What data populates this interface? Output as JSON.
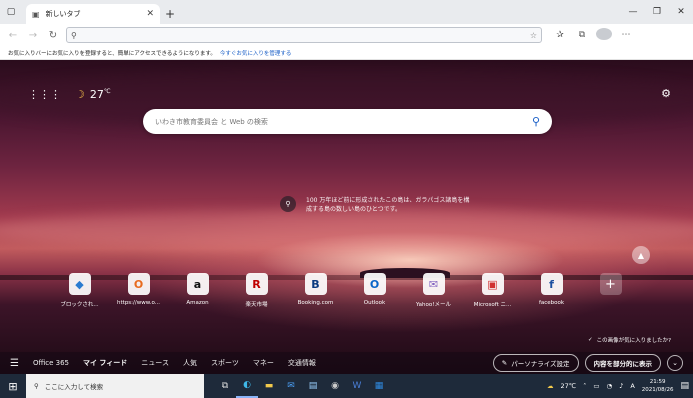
{
  "tab": {
    "title": "新しいタブ"
  },
  "address": {
    "value": ""
  },
  "favbar": {
    "message": "お気に入りバーにお気に入りを登録すると、簡単にアクセスできるようになります。",
    "link": "今すぐお気に入りを管理する"
  },
  "ntp": {
    "temperature": "27",
    "temp_unit": "℃",
    "search_placeholder": "いわき市教育委員会 と Web の検索",
    "photo_info": "100 万年ほど前に形成されたこの島は、ガラパゴス諸島を構成する島の数しい島のひとつです。"
  },
  "quicklinks": [
    {
      "label": "ブロックされ...",
      "letter": "◆",
      "color": "#2b7bd0"
    },
    {
      "label": "https://www.o...",
      "letter": "O",
      "color": "#e86b1f"
    },
    {
      "label": "Amazon",
      "letter": "a",
      "color": "#111111"
    },
    {
      "label": "楽天市場",
      "letter": "R",
      "color": "#bf0000"
    },
    {
      "label": "Booking.com",
      "letter": "B",
      "color": "#0a3a80"
    },
    {
      "label": "Outlook",
      "letter": "O",
      "color": "#0a64c8"
    },
    {
      "label": "Yahoo!メール",
      "letter": "✉",
      "color": "#8060c0"
    },
    {
      "label": "Microsoft ニ...",
      "letter": "▣",
      "color": "#d03030"
    },
    {
      "label": "facebook",
      "letter": "f",
      "color": "#1b4fa0"
    },
    {
      "label": "",
      "letter": "+",
      "color": "#ffffff"
    }
  ],
  "like_prompt": "この画像が気に入りましたか?",
  "feednav": {
    "items": [
      "Office 365",
      "マイ フィード",
      "ニュース",
      "人気",
      "スポーツ",
      "マネー",
      "交通情報"
    ],
    "personalize": "パーソナライズ設定",
    "layout": "内容を部分的に表示"
  },
  "taskbar": {
    "search_placeholder": "ここに入力して検索",
    "weather": "27℃",
    "ime": "A",
    "time": "21:59",
    "date": "2021/08/26"
  }
}
